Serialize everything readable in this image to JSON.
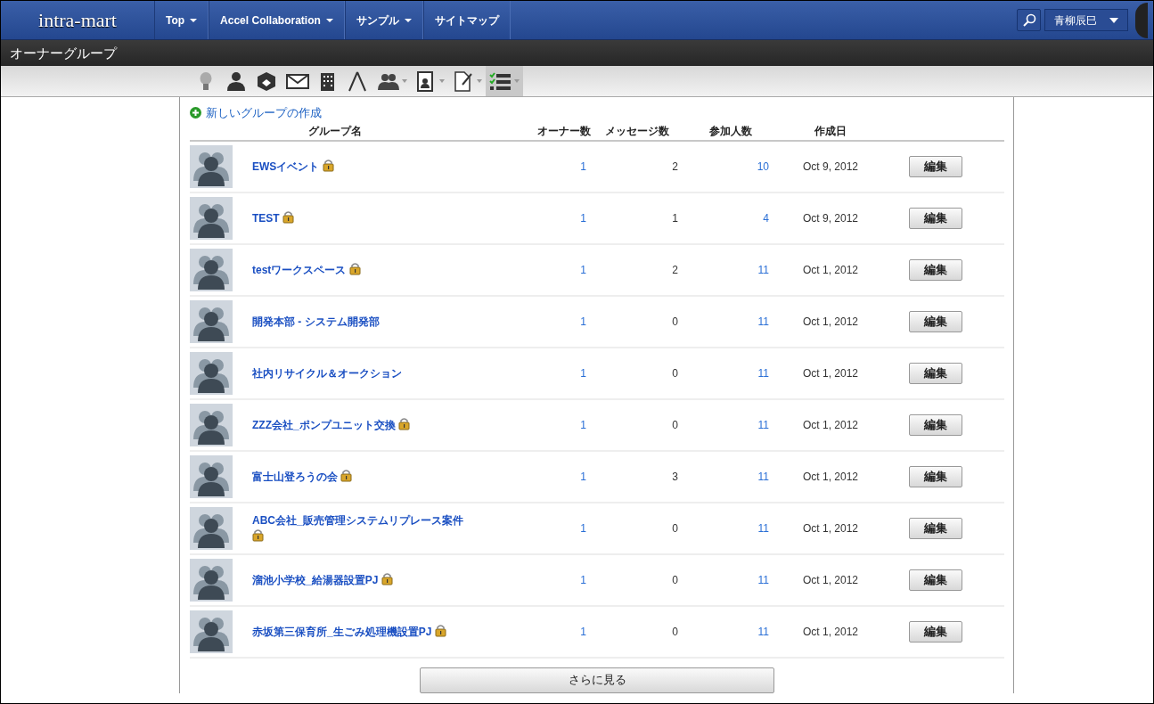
{
  "navbar": {
    "logo": "intra-mart",
    "menus": [
      {
        "label": "Top",
        "has_menu": true
      },
      {
        "label": "Accel Collaboration",
        "has_menu": true
      },
      {
        "label": "サンプル",
        "has_menu": true
      },
      {
        "label": "サイトマップ",
        "has_menu": false
      }
    ],
    "user": "青柳辰巳"
  },
  "page_title": "オーナーグループ",
  "toolbar": [
    {
      "has_menu": false,
      "selected": false
    },
    {
      "has_menu": false,
      "selected": false
    },
    {
      "has_menu": false,
      "selected": false
    },
    {
      "has_menu": false,
      "selected": false
    },
    {
      "has_menu": false,
      "selected": false
    },
    {
      "has_menu": false,
      "selected": false
    },
    {
      "has_menu": true,
      "selected": false
    },
    {
      "has_menu": true,
      "selected": false
    },
    {
      "has_menu": true,
      "selected": false
    },
    {
      "has_menu": true,
      "selected": true
    }
  ],
  "create_link": "新しいグループの作成",
  "table": {
    "columns": [
      "グループ名",
      "オーナー数",
      "メッセージ数",
      "参加人数",
      "作成日"
    ],
    "rows": [
      {
        "name": "EWSイベント",
        "locked": true,
        "owners": "1",
        "messages": "2",
        "members": "10",
        "created": "Oct 9, 2012",
        "action": "編集"
      },
      {
        "name": "TEST",
        "locked": true,
        "owners": "1",
        "messages": "1",
        "members": "4",
        "created": "Oct 9, 2012",
        "action": "編集"
      },
      {
        "name": "testワークスペース",
        "locked": true,
        "owners": "1",
        "messages": "2",
        "members": "11",
        "created": "Oct 1, 2012",
        "action": "編集"
      },
      {
        "name": "開発本部 - システム開発部",
        "locked": false,
        "owners": "1",
        "messages": "0",
        "members": "11",
        "created": "Oct 1, 2012",
        "action": "編集"
      },
      {
        "name": "社内リサイクル＆オークション",
        "locked": false,
        "owners": "1",
        "messages": "0",
        "members": "11",
        "created": "Oct 1, 2012",
        "action": "編集"
      },
      {
        "name": "ZZZ会社_ポンプユニット交換",
        "locked": true,
        "owners": "1",
        "messages": "0",
        "members": "11",
        "created": "Oct 1, 2012",
        "action": "編集"
      },
      {
        "name": "富士山登ろうの会",
        "locked": true,
        "owners": "1",
        "messages": "3",
        "members": "11",
        "created": "Oct 1, 2012",
        "action": "編集"
      },
      {
        "name": "ABC会社_販売管理システムリプレース案件",
        "locked": true,
        "owners": "1",
        "messages": "0",
        "members": "11",
        "created": "Oct 1, 2012",
        "action": "編集"
      },
      {
        "name": "溜池小学校_給湯器設置PJ",
        "locked": true,
        "owners": "1",
        "messages": "0",
        "members": "11",
        "created": "Oct 1, 2012",
        "action": "編集"
      },
      {
        "name": "赤坂第三保育所_生ごみ処理機設置PJ",
        "locked": true,
        "owners": "1",
        "messages": "0",
        "members": "11",
        "created": "Oct 1, 2012",
        "action": "編集"
      }
    ]
  },
  "more_button": "さらに見る"
}
